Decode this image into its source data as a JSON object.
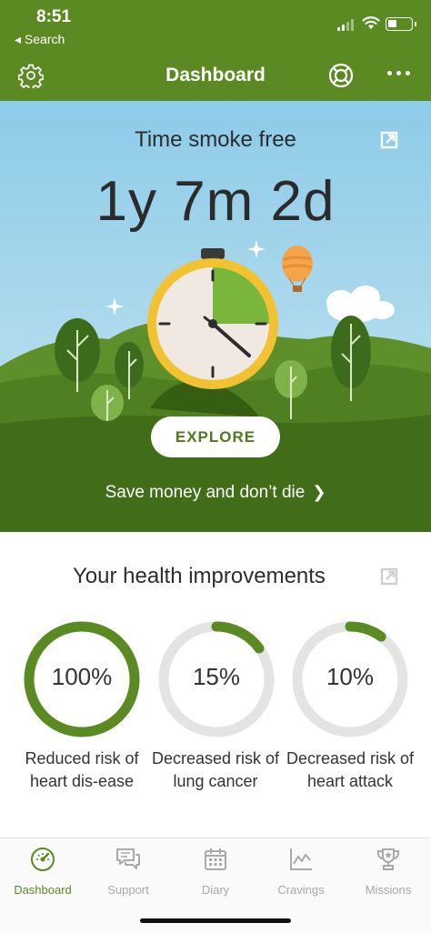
{
  "status_bar": {
    "time": "8:51",
    "back_label": "◂ Search"
  },
  "header": {
    "title": "Dashboard",
    "settings_icon": "gear-icon",
    "help_icon": "lifebuoy-icon",
    "more_icon": "more-dots-icon"
  },
  "hero": {
    "heading": "Time smoke free",
    "duration": "1y 7m 2d",
    "timer_progress": 0.25,
    "explore_label": "EXPLORE",
    "save_link": "Save money and don’t die",
    "colors": {
      "sky": "#8ccbe8",
      "grass": "#4c7a1d",
      "accent": "#5b8a22"
    }
  },
  "health": {
    "title": "Your health improvements",
    "items": [
      {
        "percent": "100%",
        "value": 100,
        "label": "Reduced risk of heart dis-ease"
      },
      {
        "percent": "15%",
        "value": 15,
        "label": "Decreased risk of lung cancer"
      },
      {
        "percent": "10%",
        "value": 10,
        "label": "Decreased risk of heart attack"
      }
    ]
  },
  "tabs": [
    {
      "label": "Dashboard",
      "icon": "speedometer-icon",
      "active": true
    },
    {
      "label": "Support",
      "icon": "chat-bubbles-icon",
      "active": false
    },
    {
      "label": "Diary",
      "icon": "calendar-icon",
      "active": false
    },
    {
      "label": "Cravings",
      "icon": "line-chart-icon",
      "active": false
    },
    {
      "label": "Missions",
      "icon": "trophy-icon",
      "active": false
    }
  ]
}
